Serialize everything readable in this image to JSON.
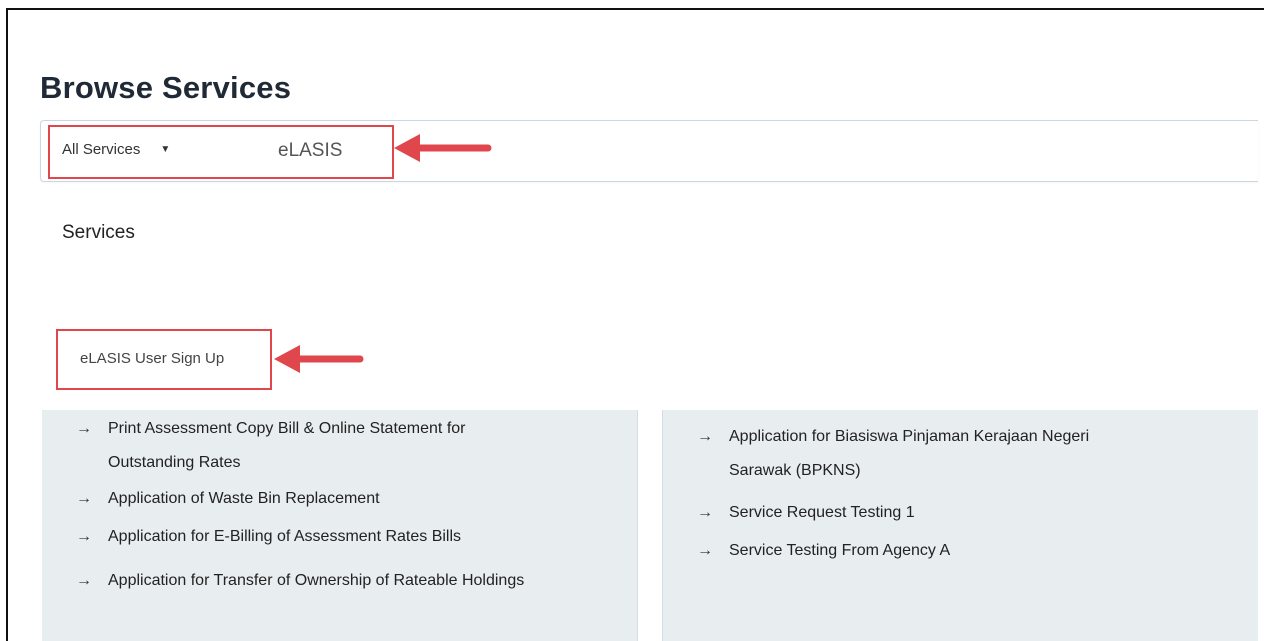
{
  "page": {
    "title": "Browse Services"
  },
  "search": {
    "category_label": "All Services",
    "query": "eLASIS"
  },
  "results": {
    "heading": "Services",
    "items": [
      {
        "label": "eLASIS User Sign Up"
      }
    ]
  },
  "services": {
    "left": [
      {
        "label": "Print Assessment Copy Bill & Online Statement for",
        "cont": "Outstanding Rates"
      },
      {
        "label": "Application of Waste Bin Replacement"
      },
      {
        "label": "Application for E-Billing of Assessment Rates Bills"
      },
      {
        "label": "Application for Transfer of Ownership of Rateable Holdings"
      }
    ],
    "right": [
      {
        "label": "Application for Biasiswa Pinjaman Kerajaan Negeri",
        "cont": "Sarawak (BPKNS)"
      },
      {
        "label": "Service Request Testing 1"
      },
      {
        "label": "Service Testing From Agency A"
      }
    ]
  },
  "theme": {
    "annotation_color": "#e0474c",
    "panel_bg": "#e8eef0",
    "arrow_glyph": "→"
  }
}
